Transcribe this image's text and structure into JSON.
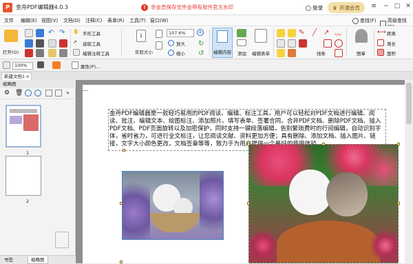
{
  "window": {
    "title": "金舟PDF编辑器4.0.3",
    "promo": "非会员保存文件会带有软件官方水印",
    "login": "登录",
    "vip_button": "开通会员"
  },
  "menu": [
    "文件",
    "编辑(E)",
    "视图(V)",
    "文档(D)",
    "注释(C)",
    "表单(R)",
    "工具(T)",
    "窗口(W)"
  ],
  "menu_right": {
    "search": "查找(F)",
    "advanced_search": "高级查找(S)"
  },
  "ribbon": {
    "open": "打开(O)",
    "hand_tool": "手形工具",
    "select_tool": "选取工具",
    "edit_annotation": "编辑注释工具",
    "actual_size": "实际大小",
    "zoom_value": "107.6%",
    "zoom_in": "放大",
    "zoom_out": "缩小",
    "edit_content": "编辑内容",
    "add": "添加",
    "edit_form": "编辑表单",
    "lines": "线条",
    "stamp": "图章",
    "distance": "距离",
    "perimeter": "周长",
    "area": "面积"
  },
  "quickbar": {
    "zoom": "100%",
    "properties": "属性(P)..."
  },
  "tabs": {
    "document": "新建文档1"
  },
  "sidebar": {
    "title": "缩略图",
    "pages": [
      "1",
      "2"
    ],
    "bottom_tabs": [
      "书签",
      "缩略图"
    ]
  },
  "document": {
    "paragraph": "金舟PDF编辑器是一款轻巧易用的PDF阅读、编辑、标注工具，用户可以轻松对PDF文档进行编辑、阅读、批注、编辑文本、绘图标注、添加照片、填写表单、签署合同、合并PDF文档、删除PDF文档、插入PDF文档、PDF页面旋转以及加密保护，同时支持一键段落编辑，告别繁琐费时的行间编辑，自动识别字体，省时省力，可进行全文标注，让您阅读文献、资料更加方便；具有删除、添加文档、插入图片、链接，文字大小颜色更改，文档签章等等，致力于为用户提供一个最好的使用体验。"
  },
  "colors": {
    "accent": "#e8552a",
    "promo": "#e0352b",
    "vip": "#f3dfa8",
    "workspace": "#8f8f8f"
  }
}
